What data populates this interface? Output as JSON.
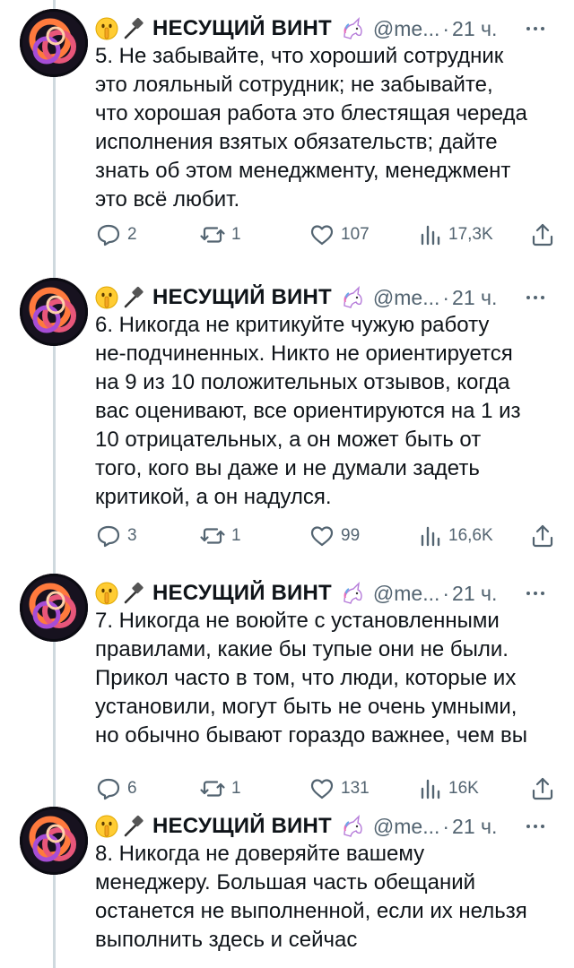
{
  "author": {
    "name": "НЕСУЩИЙ ВИНТ",
    "handle": "@me...",
    "separator": "·",
    "time": "21 ч.",
    "name_icons": [
      "shushing-face-icon",
      "hammer-icon",
      "unicorn-icon"
    ],
    "avatar_icon": "abstract-knot-avatar"
  },
  "tweets": [
    {
      "text": "5. Не забывайте, что хороший сотрудник\nэто лояльный сотрудник; не забывайте,\nчто хорошая работа это блестящая череда\nисполнения взятых обязательств; дайте\nзнать об этом менеджменту, менеджмент\nэто всё любит.",
      "replies": "2",
      "retweets": "1",
      "likes": "107",
      "views": "17,3K"
    },
    {
      "text": "6. Никогда не критикуйте чужую работу\nне-подчиненных. Никто не ориентируется\nна 9 из 10 положительных отзывов, когда\nвас оценивают, все ориентируются на 1 из\n10 отрицательных, а он может быть от\nтого, кого вы даже и не думали задеть\nкритикой, а он надулся.",
      "replies": "3",
      "retweets": "1",
      "likes": "99",
      "views": "16,6K"
    },
    {
      "text": "7. Никогда не воюйте с установленными\nправилами, какие бы тупые они не были.\nПрикол часто в том, что люди, которые их\nустановили, могут быть не очень умными,\nно обычно бывают гораздо важнее, чем вы",
      "replies": "6",
      "retweets": "1",
      "likes": "131",
      "views": "16K"
    },
    {
      "text": "8. Никогда не доверяйте вашему\nменеджеру. Большая часть обещаний\nостанется не выполненной, если их нельзя\nвыполнить здесь и сейчас",
      "replies": null,
      "retweets": null,
      "likes": null,
      "views": null
    }
  ],
  "colors": {
    "text": "#0f1419",
    "secondary": "#536471",
    "thread_line": "#cfd9de",
    "background": "#ffffff"
  }
}
